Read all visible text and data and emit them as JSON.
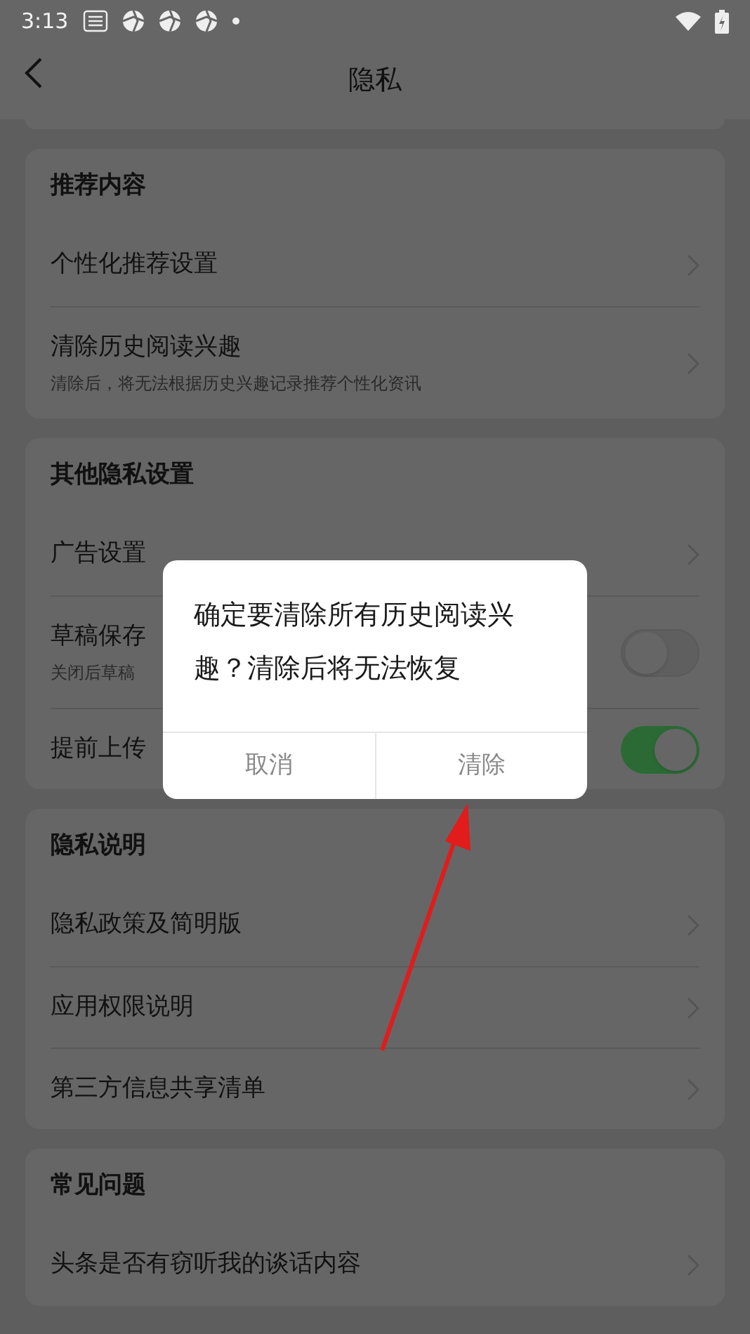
{
  "status_bar": {
    "time": "3:13"
  },
  "header": {
    "title": "隐私"
  },
  "sections": [
    {
      "title": "推荐内容",
      "rows": [
        {
          "kind": "link",
          "label": "个性化推荐设置"
        },
        {
          "kind": "link",
          "label": "清除历史阅读兴趣",
          "hint": "清除后，将无法根据历史兴趣记录推荐个性化资讯"
        }
      ]
    },
    {
      "title": "其他隐私设置",
      "rows": [
        {
          "kind": "link",
          "label": "广告设置"
        },
        {
          "kind": "toggle",
          "label": "草稿保存",
          "hint": "关闭后草稿",
          "on": false
        },
        {
          "kind": "toggle",
          "label": "提前上传",
          "on": true
        }
      ]
    },
    {
      "title": "隐私说明",
      "rows": [
        {
          "kind": "link",
          "label": "隐私政策及简明版"
        },
        {
          "kind": "link",
          "label": "应用权限说明"
        },
        {
          "kind": "link",
          "label": "第三方信息共享清单"
        }
      ]
    },
    {
      "title": "常见问题",
      "rows": [
        {
          "kind": "link",
          "label": "头条是否有窃听我的谈话内容"
        }
      ]
    }
  ],
  "dialog": {
    "message": "确定要清除所有历史阅读兴趣？清除后将无法恢复",
    "buttons": [
      {
        "label": "取消"
      },
      {
        "label": "清除"
      }
    ]
  }
}
